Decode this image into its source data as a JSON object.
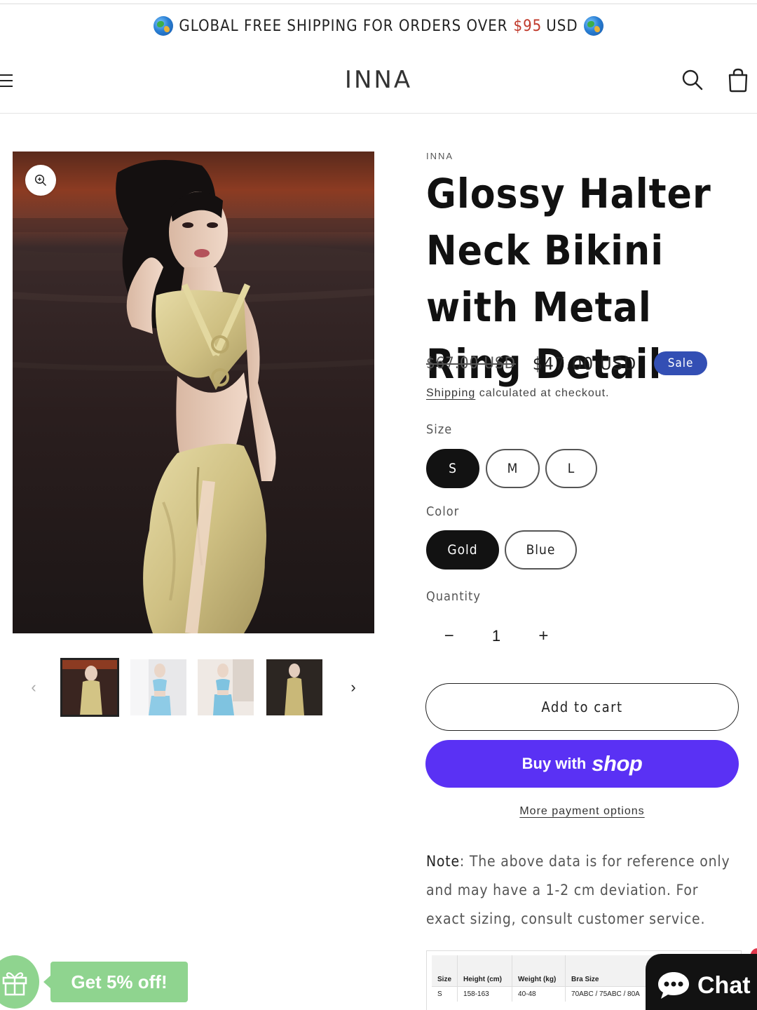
{
  "announcement": {
    "text_before": "GLOBAL FREE SHIPPING FOR ORDERS OVER",
    "price": "$95",
    "text_after": "USD"
  },
  "header": {
    "logo": "INNA"
  },
  "product": {
    "brand": "INNA",
    "title": "Glossy Halter Neck Bikini with Metal Ring Detail",
    "original_price": "$67.00 USD",
    "sale_price": "$47.00 USD",
    "sale_badge": "Sale",
    "shipping_link": "Shipping",
    "shipping_text": "calculated at checkout."
  },
  "options": {
    "size_label": "Size",
    "sizes": [
      "S",
      "M",
      "L"
    ],
    "selected_size": "S",
    "color_label": "Color",
    "colors": [
      "Gold",
      "Blue"
    ],
    "selected_color": "Gold",
    "quantity_label": "Quantity",
    "quantity": "1",
    "minus": "−",
    "plus": "+"
  },
  "actions": {
    "add_to_cart": "Add to cart",
    "buy_with": "Buy with",
    "shop_word": "shop",
    "more_payment": "More payment options"
  },
  "note": {
    "label": "Note",
    "text": ": The above data is for reference only and may have a 1-2 cm deviation. For exact sizing, consult customer service."
  },
  "size_table": {
    "headers": [
      "Size",
      "Height (cm)",
      "Weight (kg)",
      "Bra Size"
    ],
    "rows": [
      [
        "S",
        "158-163",
        "40-48",
        "70ABC / 75ABC / 80A"
      ]
    ]
  },
  "promo": {
    "discount": "Get 5% off!"
  },
  "chat": {
    "label": "Chat"
  },
  "colors": {
    "sale_badge": "#334fb4",
    "shop_pay": "#5a31f4",
    "promo_green": "#8fd48f",
    "price_accent": "#c0392b"
  },
  "icons": [
    "menu-icon",
    "search-icon",
    "cart-icon",
    "zoom-icon",
    "chevron-left-icon",
    "chevron-right-icon",
    "gift-icon",
    "chat-bubble-icon",
    "globe-icon"
  ]
}
